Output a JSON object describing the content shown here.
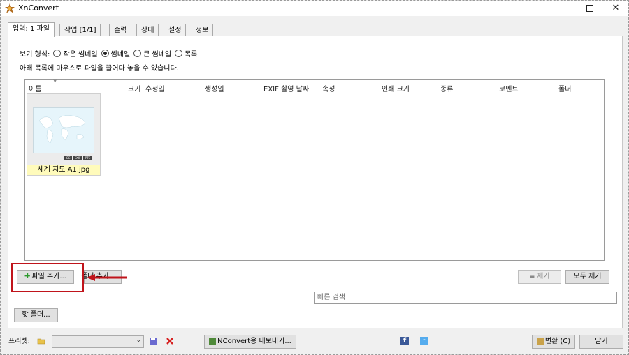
{
  "window": {
    "title": "XnConvert",
    "controls": [
      "minimize-icon",
      "maximize-icon",
      "close-icon"
    ]
  },
  "tabs": [
    {
      "label": "입력: 1 파일",
      "active": true
    },
    {
      "label": "작업 [1/1]",
      "active": false
    },
    {
      "label": "출력",
      "active": false
    },
    {
      "label": "상태",
      "active": false
    },
    {
      "label": "설정",
      "active": false
    },
    {
      "label": "정보",
      "active": false
    }
  ],
  "view_mode": {
    "label": "보기 형식:",
    "options": [
      "작은 썸네일",
      "썸네일",
      "큰 썸네일",
      "목록"
    ],
    "selected": "썸네일"
  },
  "hint": "아래 목록에 마우스로 파일을 끌어다 놓을 수 있습니다.",
  "file_list": {
    "columns": [
      "이름",
      "크기",
      "수정일",
      "생성일",
      "EXIF 촬영 날짜",
      "속성",
      "인쇄 크기",
      "종류",
      "코멘트",
      "폴더"
    ],
    "items": [
      {
        "name": "세계 지도 A1.jpg",
        "badges": [
          "ICC",
          "EXIF",
          "IPTC"
        ]
      }
    ]
  },
  "buttons": {
    "add_file": "파일 추가...",
    "add_folder_partial": "폴더 추가",
    "remove": "제거",
    "remove_all": "모두 제거",
    "hot_folder": "핫 폴더...",
    "export": "NConvert용 내보내기...",
    "convert": "변환 (C)",
    "close": "닫기"
  },
  "search": {
    "placeholder": "빠른 검색"
  },
  "footer": {
    "preset_label": "프리셋:",
    "preset_value": ""
  },
  "colors": {
    "highlight": "#c0141b",
    "thumb_caption_bg": "#fffbbb"
  }
}
